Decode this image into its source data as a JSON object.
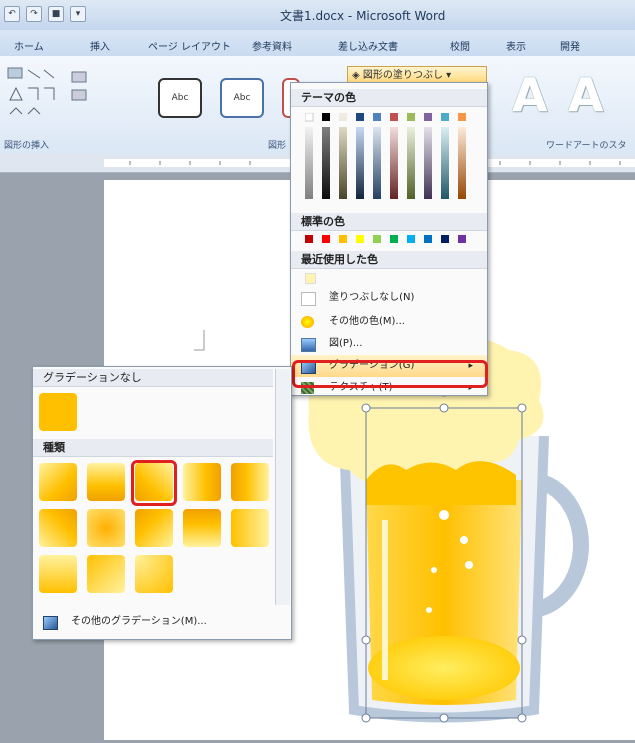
{
  "window": {
    "title": "文書1.docx - Microsoft Word"
  },
  "tabs": [
    "ホーム",
    "挿入",
    "ページ レイアウト",
    "参考資料",
    "差し込み文書",
    "校閲",
    "表示",
    "開発"
  ],
  "ribbon": {
    "group_insert_shapes": "図形の挿入",
    "group_styles": "図形",
    "group_wordart": "ワードアートのスタ",
    "style_buttons": [
      "Abc",
      "Abc"
    ],
    "wordart_letter": "A"
  },
  "fill_button": {
    "label": "図形の塗りつぶし"
  },
  "fill_menu": {
    "theme_colors_label": "テーマの色",
    "standard_colors_label": "標準の色",
    "recent_colors_label": "最近使用した色",
    "no_fill": "塗りつぶしなし(N)",
    "more_colors": "その他の色(M)...",
    "picture": "図(P)...",
    "gradient": "グラデーション(G)",
    "texture": "テクスチャ(T)",
    "theme_top_row": [
      "#ffffff",
      "#000000",
      "#eeece1",
      "#1f497d",
      "#4f81bd",
      "#c0504d",
      "#9bbb59",
      "#8064a2",
      "#4bacc6",
      "#f79646"
    ],
    "standard_row": [
      "#c00000",
      "#ff0000",
      "#ffc000",
      "#ffff00",
      "#92d050",
      "#00b050",
      "#00b0f0",
      "#0070c0",
      "#002060",
      "#7030a0"
    ]
  },
  "gradient_menu": {
    "none_label": "グラデーションなし",
    "variations_label": "種類",
    "more_gradients": "その他のグラデーション(M)..."
  },
  "colors": {
    "accent_highlight": "#e02020",
    "beer": "#ffc800",
    "foam": "#fff3b0",
    "mug": "#b8c7d9"
  }
}
